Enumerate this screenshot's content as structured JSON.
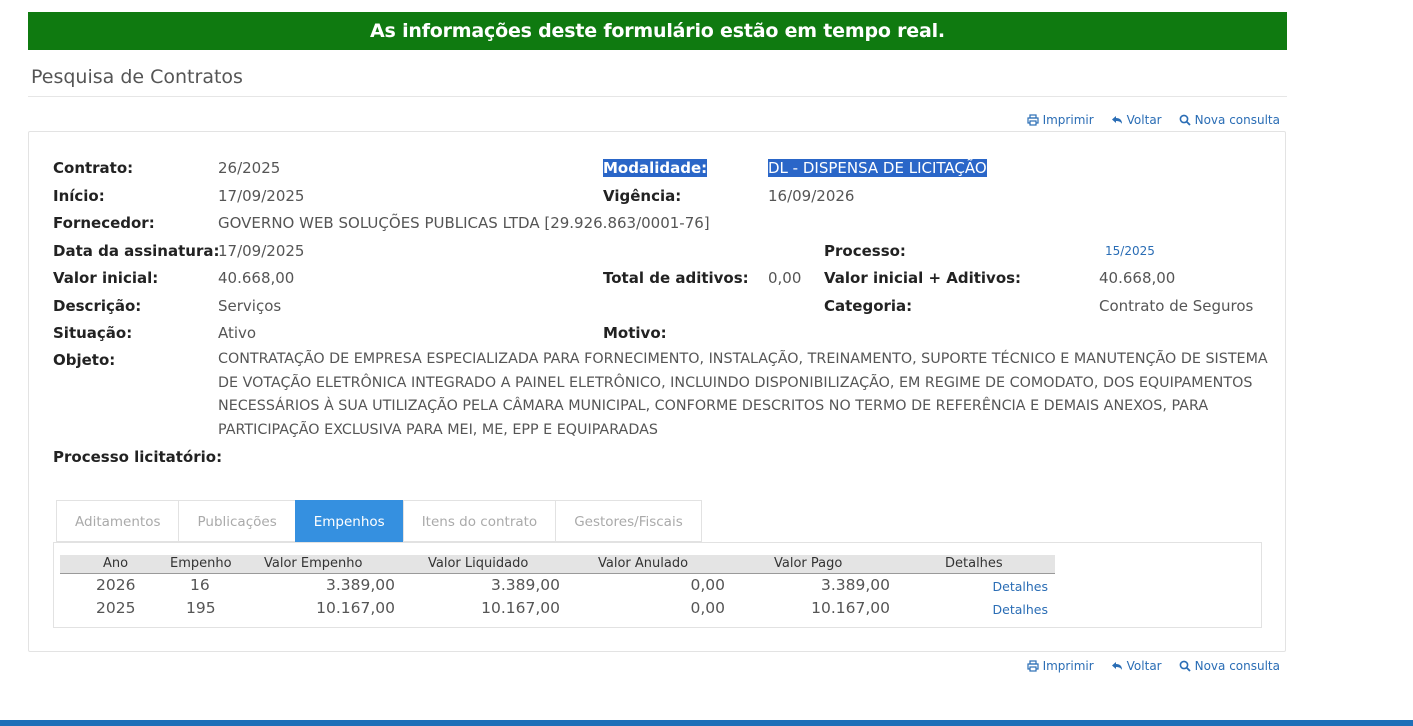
{
  "banner": "As informações deste formulário estão em tempo real.",
  "page_title": "Pesquisa de Contratos",
  "toolbar": {
    "print": "Imprimir",
    "back": "Voltar",
    "new_query": "Nova consulta"
  },
  "contract": {
    "contrato_label": "Contrato:",
    "contrato": "26/2025",
    "modalidade_label": "Modalidade:",
    "modalidade": "DL - DISPENSA DE LICITAÇÃO",
    "inicio_label": "Início:",
    "inicio": "17/09/2025",
    "vigencia_label": "Vigência:",
    "vigencia": "16/09/2026",
    "fornecedor_label": "Fornecedor:",
    "fornecedor": "GOVERNO WEB SOLUÇÕES PUBLICAS LTDA [29.926.863/0001-76]",
    "data_assinatura_label": "Data da assinatura:",
    "data_assinatura": "17/09/2025",
    "processo_label": "Processo:",
    "processo": "15/2025",
    "valor_inicial_label": "Valor inicial:",
    "valor_inicial": "40.668,00",
    "total_aditivos_label": "Total de aditivos:",
    "total_aditivos": "0,00",
    "valor_inicial_aditivos_label": "Valor inicial + Aditivos:",
    "valor_inicial_aditivos": "40.668,00",
    "descricao_label": "Descrição:",
    "descricao": "Serviços",
    "categoria_label": "Categoria:",
    "categoria": "Contrato de Seguros",
    "situacao_label": "Situação:",
    "situacao": "Ativo",
    "motivo_label": "Motivo:",
    "objeto_label": "Objeto:",
    "objeto": "CONTRATAÇÃO DE EMPRESA ESPECIALIZADA PARA FORNECIMENTO, INSTALAÇÃO, TREINAMENTO, SUPORTE TÉCNICO E MANUTENÇÃO DE SISTEMA DE VOTAÇÃO ELETRÔNICA INTEGRADO A PAINEL ELETRÔNICO, INCLUINDO DISPONIBILIZAÇÃO, EM REGIME DE COMODATO, DOS EQUIPAMENTOS NECESSÁRIOS À SUA UTILIZAÇÃO PELA CÂMARA MUNICIPAL, CONFORME DESCRITOS NO TERMO DE REFERÊNCIA E DEMAIS ANEXOS, PARA PARTICIPAÇÃO EXCLUSIVA PARA MEI, ME, EPP E EQUIPARADAS",
    "processo_licitatorio_label": "Processo licitatório:"
  },
  "tabs": [
    "Aditamentos",
    "Publicações",
    "Empenhos",
    "Itens do contrato",
    "Gestores/Fiscais"
  ],
  "active_tab": "Empenhos",
  "empenhos": {
    "headers": [
      "Ano",
      "Empenho",
      "Valor Empenho",
      "Valor Liquidado",
      "Valor Anulado",
      "Valor Pago",
      "Detalhes"
    ],
    "rows": [
      [
        "2026",
        "16",
        "3.389,00",
        "3.389,00",
        "0,00",
        "3.389,00",
        "Detalhes"
      ],
      [
        "2025",
        "195",
        "10.167,00",
        "10.167,00",
        "0,00",
        "10.167,00",
        "Detalhes"
      ]
    ]
  },
  "colors": {
    "banner": "#0f7a10",
    "link": "#2a6db5",
    "active_tab": "#3590e0",
    "highlight": "#2a66c8"
  }
}
